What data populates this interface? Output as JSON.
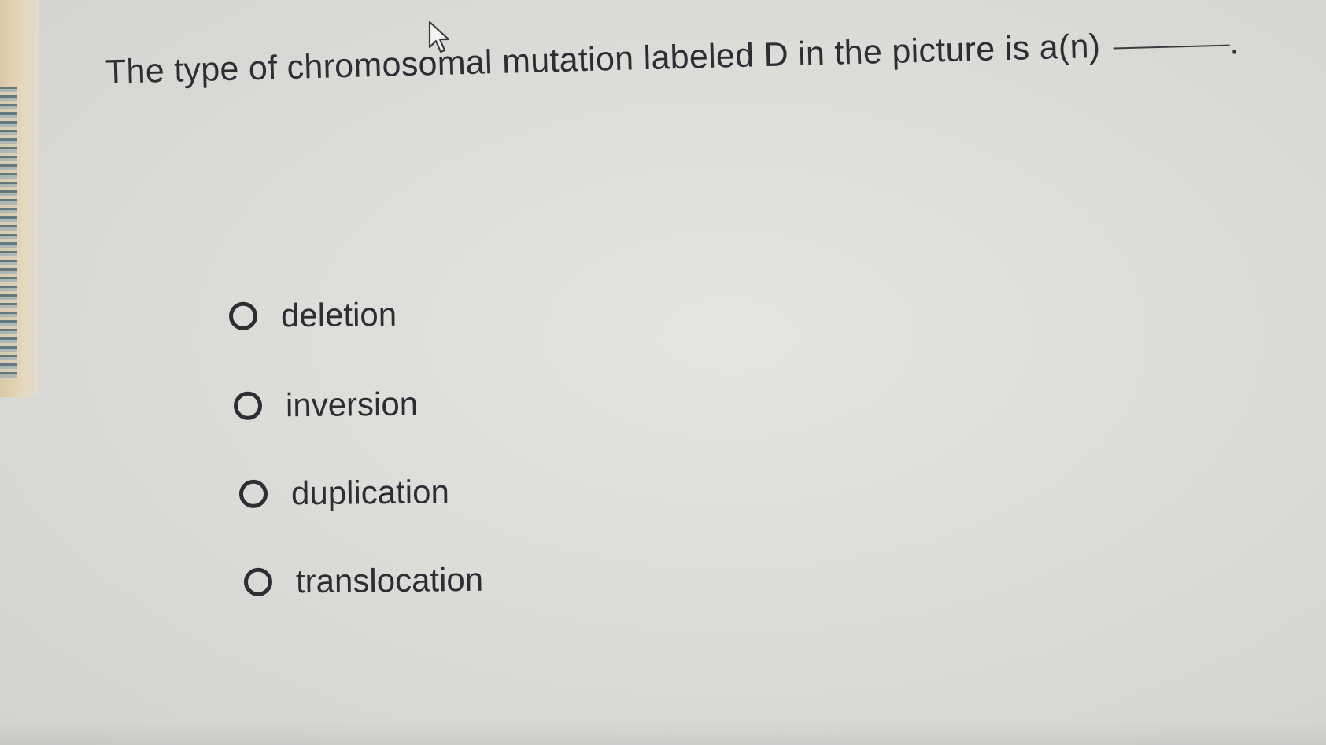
{
  "question": {
    "text": "The type of chromosomal mutation labeled D in the picture is a(n)",
    "period": "."
  },
  "options": [
    {
      "label": "deletion"
    },
    {
      "label": "inversion"
    },
    {
      "label": "duplication"
    },
    {
      "label": "translocation"
    }
  ],
  "icons": {
    "cursor": "mouse-pointer-icon",
    "radio": "radio-unselected"
  },
  "colors": {
    "text": "#2b2f33",
    "background": "#dcdcd9"
  }
}
